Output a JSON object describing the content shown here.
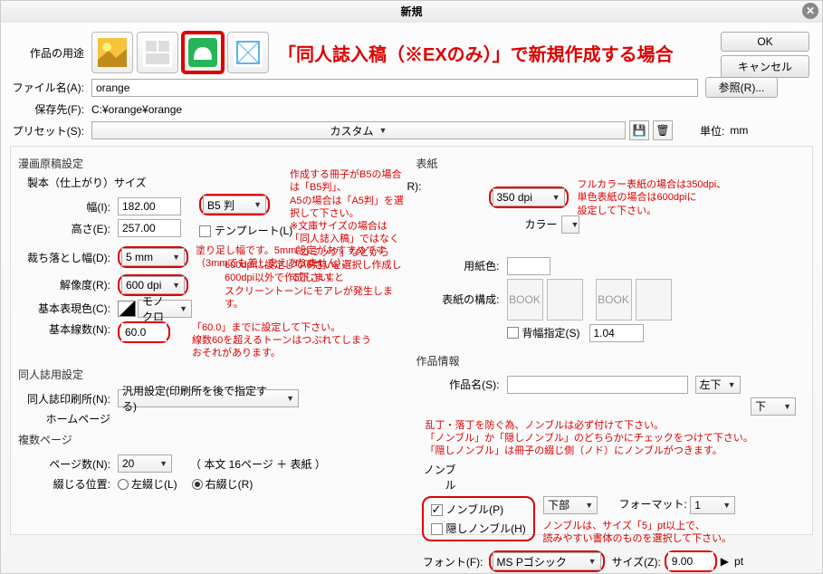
{
  "title": "新規",
  "buttons": {
    "ok": "OK",
    "cancel": "キャンセル",
    "browse": "参照(R)..."
  },
  "labels": {
    "purpose": "作品の用途",
    "filename": "ファイル名(A):",
    "saveto": "保存先(F):",
    "preset": "プリセット(S):",
    "unit": "単位:",
    "unit_val": "mm"
  },
  "filename": "orange",
  "saveto": "C:¥orange¥orange",
  "preset": "カスタム",
  "banner": "「同人誌入稿（※EXのみ）」で新規作成する場合",
  "manga": {
    "title": "漫画原稿設定",
    "finish": "製本（仕上がり）サイズ",
    "width_lbl": "幅(I):",
    "width": "182.00",
    "height_lbl": "高さ(E):",
    "height": "257.00",
    "size_preset": "B5 判",
    "template_lbl": "テンプレート(L)",
    "bleed_lbl": "裁ち落とし幅(D):",
    "bleed": "5 mm",
    "res_lbl": "解像度(R):",
    "res": "600 dpi",
    "color_lbl": "基本表現色(C):",
    "color": "モノクロ",
    "lines_lbl": "基本線数(N):",
    "lines": "60.0"
  },
  "annot": {
    "size": "作成する冊子がB5の場合は「B5判」、\nA5の場合は「A5判」を選択して下さい。\n※文庫サイズの場合は「同人誌入稿」ではなく\n「コミック」などから「A6判」を選択し作成して下さい。",
    "bleed": "塗り足し幅です。5mm設定がおすすめです\n（3mmでも差し支えありません）。",
    "res": "600dpiに設定して下さい。\n600dpi以外で作成しますと\nスクリーントーンにモアレが発生します。",
    "lines": "「60.0」までに設定して下さい。\n線数60を超えるトーンはつぶれてしまう\nおそれがあります。",
    "cover_dpi": "フルカラー表紙の場合は350dpi、\n単色表紙の場合は600dpiに\n設定して下さい。",
    "nombre1": "乱丁・落丁を防ぐ為、ノンブルは必ず付けて下さい。\n「ノンブル」か「隠しノンブル」のどちらかにチェックをつけて下さい。\n「隠しノンブル」は冊子の綴じ側（ノド）にノンブルがつきます。",
    "nombre2": "ノンブルは、サイズ「5」pt以上で、\n読みやすい書体のものを選択して下さい。"
  },
  "doujin": {
    "title": "同人誌用設定",
    "printer_lbl": "同人誌印刷所(N):",
    "printer": "汎用設定(印刷所を後で指定する)",
    "homepage": "ホームページ"
  },
  "multi": {
    "title": "複数ページ",
    "pages_lbl": "ページ数(N):",
    "pages": "20",
    "pages_note": "（ 本文 16ページ ＋ 表紙 ）",
    "bind_lbl": "綴じる位置:",
    "bind_left": "左綴じ(L)",
    "bind_right": "右綴じ(R)"
  },
  "cover": {
    "title": "表紙",
    "res": "350 dpi",
    "color_lbl": "カラー",
    "paper_lbl": "用紙色:",
    "layout_lbl": "表紙の構成:",
    "book_label": "BOOK",
    "spine_lbl": "背幅指定(S)",
    "spine": "1.04"
  },
  "info": {
    "title": "作品情報",
    "name_lbl": "作品名(S):",
    "pos1": "左下",
    "pos2": "下",
    "nombre_title": "ノンブル",
    "nombre_chk": "ノンブル(P)",
    "hidden_chk": "隠しノンブル(H)",
    "nombre_pos": "下部",
    "format_lbl": "フォーマット:",
    "format": "1",
    "font_lbl": "フォント(F):",
    "font": "MS Pゴシック",
    "size_lbl": "サイズ(Z):",
    "size": "9.00",
    "pt": "pt"
  }
}
